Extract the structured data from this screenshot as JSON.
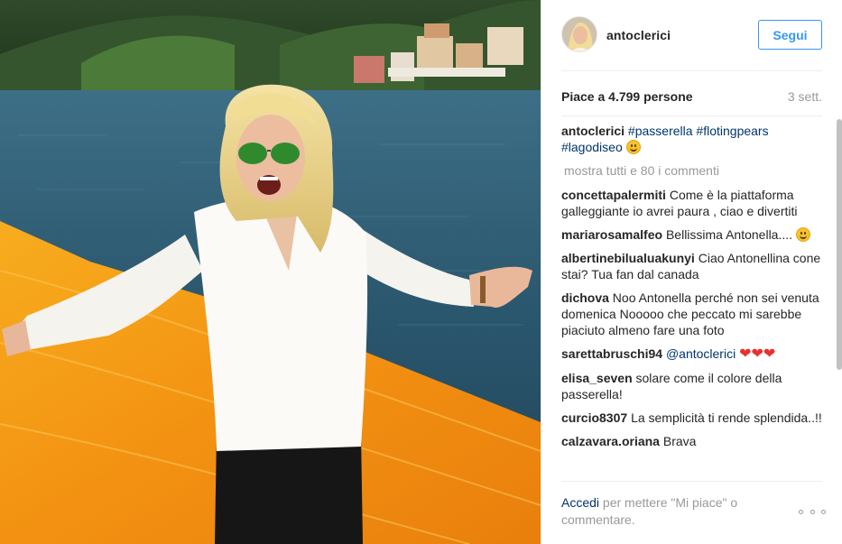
{
  "post": {
    "photo_icon": "photo-lake-passerella"
  },
  "header": {
    "username": "antoclerici",
    "follow_label": "Segui",
    "avatar_icon": "avatar-icon"
  },
  "stats": {
    "likes": "Piace a 4.799 persone",
    "time": "3 sett."
  },
  "caption": {
    "user": "antoclerici",
    "tags": [
      "#passerella",
      "#flotingpears",
      "#lagodiseo"
    ]
  },
  "load_more": "mostra tutti e 80 i commenti",
  "comments": [
    {
      "user": "concettapalermiti",
      "text": "Come è la piattaforma galleggiante io avrei paura , ciao e divertiti"
    },
    {
      "user": "mariarosamalfeo",
      "text": "Bellissima Antonella...."
    },
    {
      "user": "albertinebilualuakunyi",
      "text": "Ciao Antonellina cone stai? Tua fan dal canada"
    },
    {
      "user": "dichova",
      "text": "Noo Antonella perché non sei venuta domenica Nooooo che peccato mi sarebbe piaciuto almeno fare una foto"
    },
    {
      "user": "sarettabruschi94",
      "mention": "@antoclerici"
    },
    {
      "user": "elisa_seven",
      "text": "solare come il colore della passerella!"
    },
    {
      "user": "curcio8307",
      "text": "La semplicità ti rende splendida..!!"
    },
    {
      "user": "calzavara.oriana",
      "text": "Brava"
    }
  ],
  "footer": {
    "login": "Accedi",
    "rest": "per mettere \"Mi piace\" o commentare."
  },
  "colors": {
    "accent": "#3897f0",
    "link": "#003569",
    "muted": "#999999",
    "passerella": "#f29a12"
  }
}
